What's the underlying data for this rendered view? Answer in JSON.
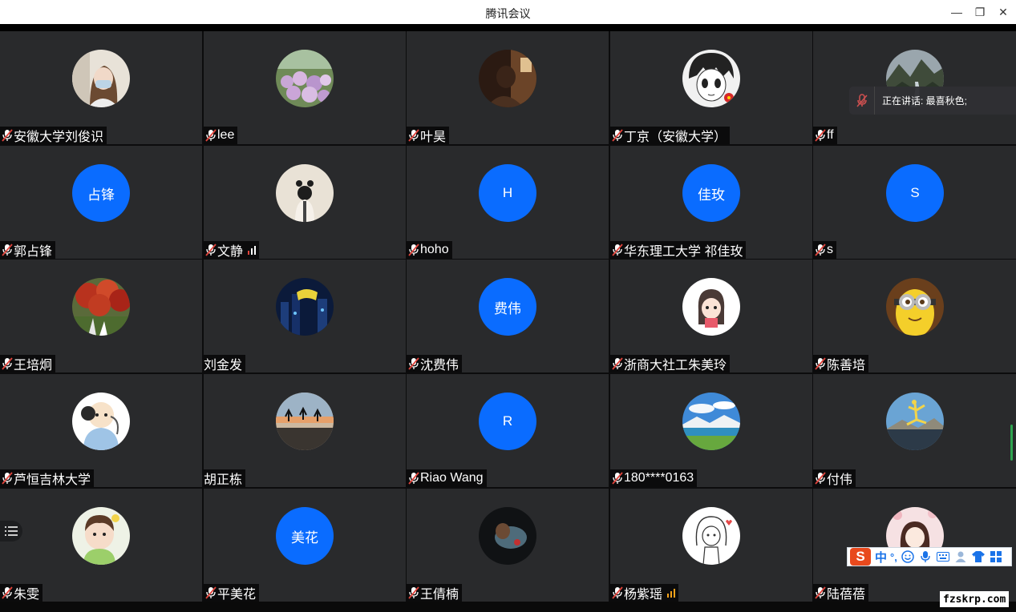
{
  "window": {
    "title": "腾讯会议",
    "minimize_icon": "—",
    "restore_icon": "❐",
    "close_icon": "✕"
  },
  "colors": {
    "avatar_blue": "#0a6cff",
    "tile_bg": "#292a2c",
    "mic_muted_red": "#e0443c",
    "signal_orange": "#f3a21a",
    "speaking_green": "#2ea44f"
  },
  "participants": [
    {
      "name": "安徽大学刘俊识",
      "avatar_type": "photo",
      "photo": "woman-mask",
      "muted": true
    },
    {
      "name": "lee",
      "avatar_type": "photo",
      "photo": "flowers",
      "muted": true
    },
    {
      "name": "叶昊",
      "avatar_type": "photo",
      "photo": "dark-room",
      "muted": true
    },
    {
      "name": "丁京（安徽大学）",
      "avatar_type": "photo",
      "photo": "anime-boy",
      "muted": true
    },
    {
      "name": "ff",
      "avatar_type": "photo",
      "photo": "mountains",
      "muted": true
    },
    {
      "name": "郭占锋",
      "avatar_type": "text",
      "avatar_text": "占锋",
      "muted": true
    },
    {
      "name": "文静",
      "avatar_type": "photo",
      "photo": "girl-back",
      "muted": true,
      "signal": "weak-red"
    },
    {
      "name": "hoho",
      "avatar_type": "text",
      "avatar_text": "H",
      "muted": true
    },
    {
      "name": "华东理工大学 祁佳玫",
      "avatar_type": "text",
      "avatar_text": "佳玫",
      "muted": true
    },
    {
      "name": "s",
      "avatar_type": "text",
      "avatar_text": "S",
      "muted": true
    },
    {
      "name": "王培炯",
      "avatar_type": "photo",
      "photo": "autumn-tree",
      "muted": true
    },
    {
      "name": "刘金发",
      "avatar_type": "photo",
      "photo": "night-city",
      "muted": false
    },
    {
      "name": "沈费伟",
      "avatar_type": "text",
      "avatar_text": "费伟",
      "muted": true
    },
    {
      "name": "浙商大社工朱美玲",
      "avatar_type": "photo",
      "photo": "cartoon-girl",
      "muted": true
    },
    {
      "name": "陈善培",
      "avatar_type": "photo",
      "photo": "minion",
      "muted": true
    },
    {
      "name": "芦恒吉林大学",
      "avatar_type": "photo",
      "photo": "cartoon-monk",
      "muted": true
    },
    {
      "name": "胡正栋",
      "avatar_type": "photo",
      "photo": "beach-jump",
      "muted": false
    },
    {
      "name": "Riao Wang",
      "avatar_type": "text",
      "avatar_text": "R",
      "muted": true
    },
    {
      "name": "180****0163",
      "avatar_type": "photo",
      "photo": "lake-sky",
      "muted": true
    },
    {
      "name": "付伟",
      "avatar_type": "photo",
      "photo": "yoga",
      "muted": true
    },
    {
      "name": "朱雯",
      "avatar_type": "photo",
      "photo": "baby",
      "muted": true
    },
    {
      "name": "平美花",
      "avatar_type": "text",
      "avatar_text": "美花",
      "muted": true
    },
    {
      "name": "王倩楠",
      "avatar_type": "photo",
      "photo": "dark-figure",
      "muted": true
    },
    {
      "name": "杨紫瑶",
      "avatar_type": "photo",
      "photo": "sketch-girl",
      "muted": true,
      "signal": "medium-orange"
    },
    {
      "name": "陆蓓蓓",
      "avatar_type": "photo",
      "photo": "pink-girl",
      "muted": true
    }
  ],
  "speaking": {
    "text": "正在讲话: 最喜秋色;"
  },
  "ime": {
    "logo": "S",
    "mode": "中",
    "punct": "°,",
    "icons": [
      "smile-icon",
      "microphone-icon",
      "keyboard-icon",
      "user-icon",
      "shirt-icon",
      "grid-icon"
    ]
  },
  "watermark": "fzskrp.com"
}
